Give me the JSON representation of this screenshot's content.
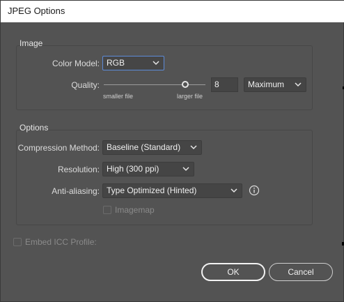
{
  "window": {
    "title": "JPEG Options"
  },
  "image_group": {
    "legend": "Image",
    "color_model": {
      "label": "Color Model:",
      "value": "RGB"
    },
    "quality": {
      "label": "Quality:",
      "value": "8",
      "level_fraction": 0.8,
      "smaller_hint": "smaller file",
      "larger_hint": "larger file",
      "preset": "Maximum"
    }
  },
  "options_group": {
    "legend": "Options",
    "compression": {
      "label": "Compression Method:",
      "value": "Baseline (Standard)"
    },
    "resolution": {
      "label": "Resolution:",
      "value": "High (300 ppi)"
    },
    "anti_aliasing": {
      "label": "Anti-aliasing:",
      "value": "Type Optimized (Hinted)"
    },
    "imagemap": {
      "label": "Imagemap",
      "checked": false,
      "enabled": false
    }
  },
  "embed_icc": {
    "label": "Embed ICC Profile:",
    "checked": false,
    "enabled": false
  },
  "buttons": {
    "ok": "OK",
    "cancel": "Cancel"
  },
  "colors": {
    "dialog_bg": "#535353",
    "field_bg": "#454545",
    "focus_border": "#5d8bd8",
    "text": "#dcdcdc",
    "disabled_text": "#8a8a8a"
  }
}
